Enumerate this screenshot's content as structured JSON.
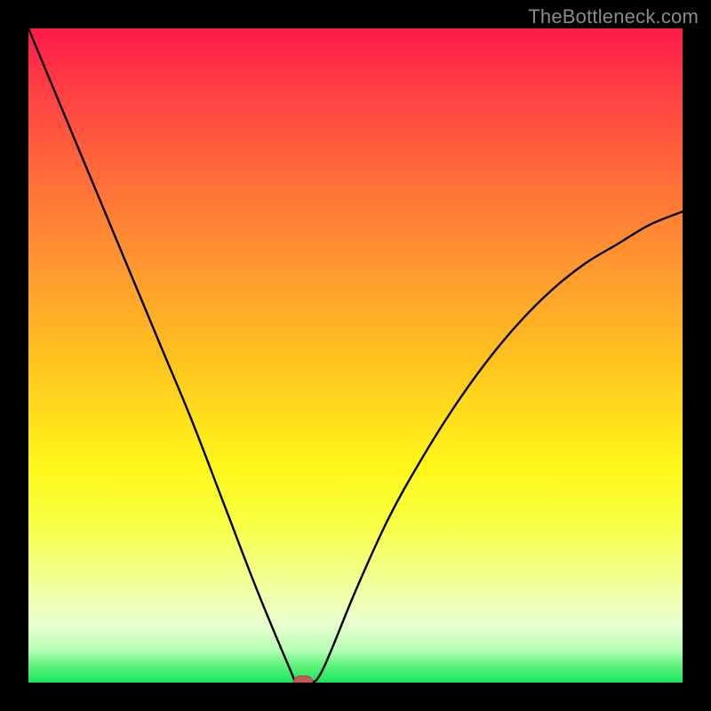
{
  "watermark": "TheBottleneck.com",
  "chart_data": {
    "type": "line",
    "title": "",
    "xlabel": "",
    "ylabel": "",
    "xlim": [
      0,
      100
    ],
    "ylim": [
      0,
      100
    ],
    "x": [
      0,
      5,
      10,
      15,
      20,
      25,
      30,
      35,
      40,
      41,
      43,
      45,
      50,
      55,
      60,
      65,
      70,
      75,
      80,
      85,
      90,
      95,
      100
    ],
    "y": [
      100,
      88,
      76,
      64,
      52,
      40,
      27,
      14,
      2,
      0,
      0,
      2,
      14,
      25,
      34,
      42,
      49,
      55,
      60,
      64,
      67,
      70,
      72
    ],
    "marker": {
      "x": 42,
      "y": 0
    },
    "gradient_stops": [
      {
        "pos": 0,
        "color": "#ff1a4b"
      },
      {
        "pos": 0.22,
        "color": "#ff6a3a"
      },
      {
        "pos": 0.52,
        "color": "#ffc61e"
      },
      {
        "pos": 0.76,
        "color": "#f8ff45"
      },
      {
        "pos": 0.95,
        "color": "#b6ffb6"
      },
      {
        "pos": 1.0,
        "color": "#18e45b"
      }
    ]
  }
}
